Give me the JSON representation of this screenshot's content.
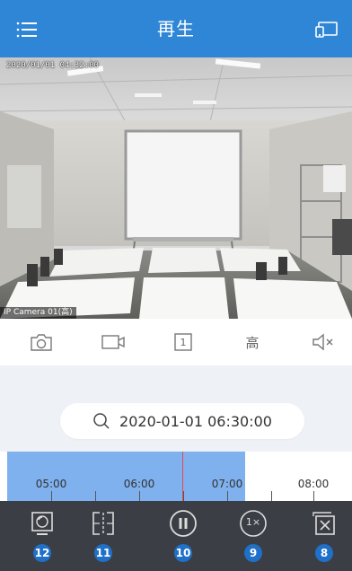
{
  "header": {
    "title": "再生",
    "menu_icon": "menu-icon",
    "cast_icon": "cast-icon"
  },
  "video": {
    "timestamp": "2020/01/01 04:32:00",
    "camera_label": "IP Camera 01(高)"
  },
  "controls": {
    "snapshot_icon": "camera-icon",
    "record_icon": "video-record-icon",
    "channel_label": "1",
    "quality_label": "高",
    "mute_icon": "speaker-mute-icon"
  },
  "search": {
    "datetime": "2020-01-01 06:30:00",
    "icon": "search-icon"
  },
  "timeline": {
    "labels": [
      "05:00",
      "06:00",
      "07:00",
      "08:00"
    ],
    "playhead_time": "06:30"
  },
  "bottom_bar": {
    "items": [
      {
        "icon": "display-mode-icon",
        "badge": "12"
      },
      {
        "icon": "split-view-icon",
        "badge": "11"
      },
      {
        "icon": "pause-icon",
        "badge": "10"
      },
      {
        "icon": "speed-icon",
        "speed": "1×",
        "badge": "9"
      },
      {
        "icon": "close-window-icon",
        "badge": "8"
      }
    ]
  },
  "colors": {
    "header": "#2f86d6",
    "recorded_segment": "#7fb1ee",
    "playhead": "#e34a4a",
    "bottom_bar": "#3b3f45",
    "badge": "#1f70c8"
  }
}
